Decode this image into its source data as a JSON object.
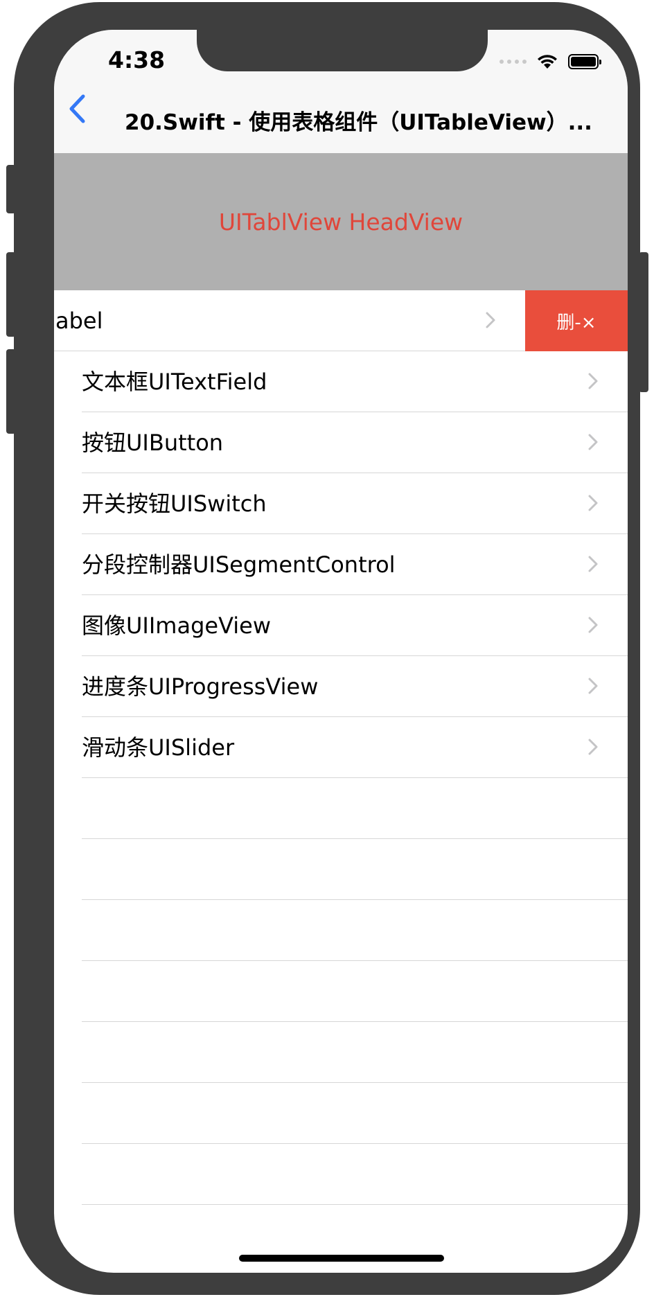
{
  "status_bar": {
    "time": "4:38"
  },
  "nav": {
    "title": "20.Swift - 使用表格组件（UITableView）..."
  },
  "table": {
    "header_text": "UITablView HeadView",
    "swiped_row": {
      "label": "abel",
      "delete_label": "删-×"
    },
    "rows": [
      {
        "label": "文本框UITextField"
      },
      {
        "label": "按钮UIButton"
      },
      {
        "label": "开关按钮UISwitch"
      },
      {
        "label": "分段控制器UISegmentControl"
      },
      {
        "label": "图像UIImageView"
      },
      {
        "label": "进度条UIProgressView"
      },
      {
        "label": "滑动条UISlider"
      }
    ]
  },
  "colors": {
    "accent": "#3478f6",
    "delete": "#e94e3c",
    "header_bg": "#b0b0b0",
    "header_text": "#e0463a"
  }
}
